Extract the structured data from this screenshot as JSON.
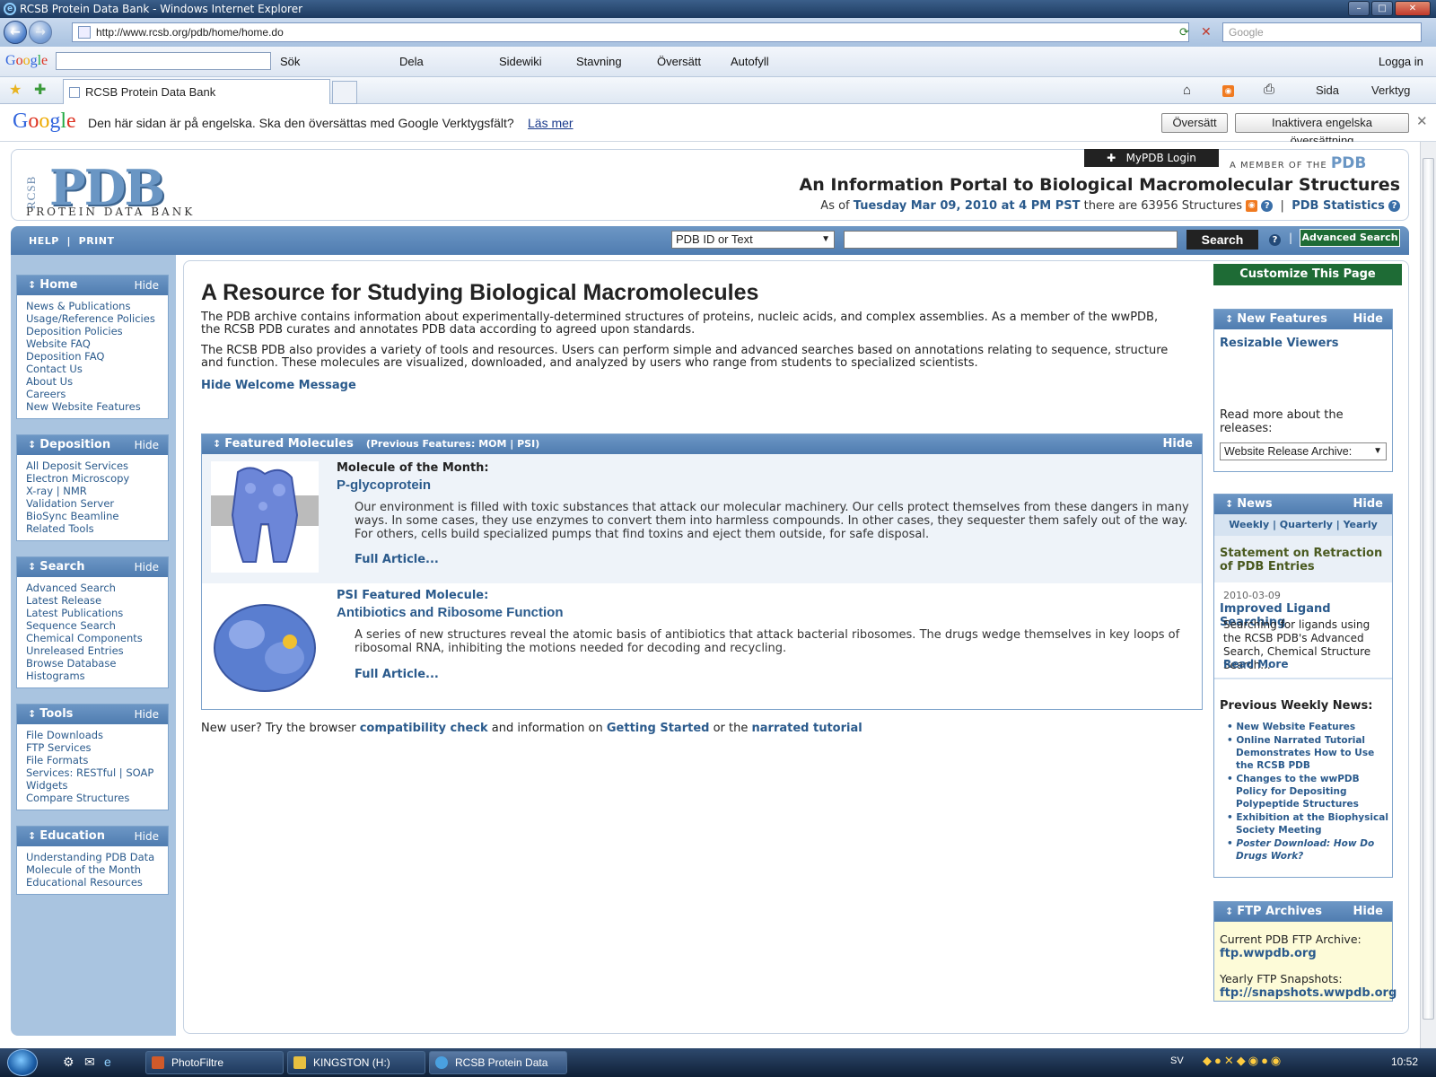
{
  "window": {
    "title": "RCSB Protein Data Bank - Windows Internet Explorer"
  },
  "browser": {
    "url": "http://www.rcsb.org/pdb/home/home.do",
    "search_placeholder": "Google",
    "tab_label": "RCSB Protein Data Bank",
    "google_toolbar": [
      "Sök",
      "Dela",
      "Sidewiki",
      "Stavning",
      "Översätt",
      "Autofyll",
      "Logga in"
    ],
    "command_bar": [
      "Sida",
      "Verktyg"
    ],
    "google_logo": "Google"
  },
  "translate_bar": {
    "message": "Den här sidan är på engelska. Ska den översättas med Google Verktygsfält?",
    "learn_more": "Läs mer",
    "translate_button": "Översätt",
    "disable_button": "Inaktivera engelska översättning"
  },
  "header": {
    "logo_rcsb": "RCSB",
    "logo_pdb": "PDB",
    "logo_sub": "PROTEIN DATA BANK",
    "mypdb": "MyPDB Login",
    "member_text": "A MEMBER OF THE",
    "member_pdb": "PDB",
    "portal_title": "An Information Portal to Biological Macromolecular Structures",
    "as_of": "As of",
    "date": "Tuesday Mar 09, 2010 at 4 PM PST",
    "there_are": "there are 63956 Structures",
    "stats_link": "PDB Statistics"
  },
  "searchbar": {
    "help": "HELP",
    "print": "PRINT",
    "select_value": "PDB ID or Text",
    "search_button": "Search",
    "advanced": "Advanced Search"
  },
  "sidebar": [
    {
      "title": "Home",
      "items": [
        "News & Publications",
        "Usage/Reference Policies",
        "Deposition Policies",
        "Website FAQ",
        "Deposition FAQ",
        "Contact Us",
        "About Us",
        "Careers",
        "New Website Features"
      ]
    },
    {
      "title": "Deposition",
      "items": [
        "All Deposit Services",
        "Electron Microscopy",
        "X-ray | NMR",
        "Validation Server",
        "BioSync Beamline",
        "Related Tools"
      ]
    },
    {
      "title": "Search",
      "items": [
        "Advanced Search",
        "Latest Release",
        "Latest Publications",
        "Sequence Search",
        "Chemical Components",
        "Unreleased Entries",
        "Browse Database",
        "Histograms"
      ]
    },
    {
      "title": "Tools",
      "items": [
        "File Downloads",
        "FTP Services",
        "File Formats",
        "Services: RESTful | SOAP",
        "Widgets",
        "Compare Structures"
      ]
    },
    {
      "title": "Education",
      "items": [
        "Understanding PDB Data",
        "Molecule of the Month",
        "Educational Resources"
      ]
    }
  ],
  "sidebar_hide": "Hide",
  "main": {
    "title": "A Resource for Studying Biological Macromolecules",
    "p1": "The PDB archive contains information about experimentally-determined structures of proteins, nucleic acids, and complex assemblies. As a member of the wwPDB, the RCSB PDB curates and annotates PDB data according to agreed upon standards.",
    "p2": "The RCSB PDB also provides a variety of tools and resources. Users can perform simple and advanced searches based on annotations relating to sequence, structure and function. These molecules are visualized, downloaded, and analyzed by users who range from students to specialized scientists.",
    "hide_welcome": "Hide Welcome Message",
    "featured_title": "Featured Molecules",
    "previous_features": "(Previous Features: MOM | PSI)",
    "mom_tag": "Molecule of the Month:",
    "mom_title": "P-glycoprotein",
    "mom_desc": "Our environment is filled with toxic substances that attack our molecular machinery. Our cells protect themselves from these dangers in many ways. In some cases, they use enzymes to convert them into harmless compounds. In other cases, they sequester them safely out of the way. For others, cells build specialized pumps that find toxins and eject them outside, for safe disposal.",
    "full_article": "Full Article...",
    "psi_tag": "PSI Featured Molecule:",
    "psi_title": "Antibiotics and Ribosome Function",
    "psi_desc": "A series of new structures reveal the atomic basis of antibiotics that attack bacterial ribosomes. The drugs wedge themselves in key loops of ribosomal RNA, inhibiting the motions needed for decoding and recycling.",
    "newuser_1": "New user? Try the browser",
    "newuser_link1": "compatibility check",
    "newuser_2": "and information on",
    "newuser_link2": "Getting Started",
    "newuser_3": "or the",
    "newuser_link3": "narrated tutorial"
  },
  "right": {
    "customize": "Customize This Page",
    "new_features_title": "New Features",
    "resizable": "Resizable Viewers",
    "read_more_releases": "Read more about the releases:",
    "release_select": "Website Release Archive:",
    "news_title": "News",
    "news_tabs": "Weekly | Quarterly | Yearly",
    "statement": "Statement on Retraction of PDB Entries",
    "news_date": "2010-03-09",
    "news_headline": "Improved Ligand Searching",
    "news_body": "Searching for ligands using the RCSB PDB's Advanced Search, Chemical Structure Search...",
    "read_more": "Read More",
    "prev_weekly": "Previous Weekly News:",
    "prev_items": [
      "New Website Features",
      "Online Narrated Tutorial Demonstrates How to Use the RCSB PDB",
      "Changes to the wwPDB Policy for Depositing Polypeptide Structures",
      "Exhibition at the Biophysical Society Meeting",
      "Poster Download: How Do Drugs Work?"
    ],
    "ftp_title": "FTP Archives",
    "ftp_current_label": "Current PDB FTP Archive:",
    "ftp_current": "ftp.wwpdb.org",
    "ftp_yearly_label": "Yearly FTP Snapshots:",
    "ftp_yearly": "ftp://snapshots.wwpdb.org",
    "hide": "Hide"
  },
  "taskbar": {
    "items": [
      "PhotoFiltre",
      "KINGSTON (H:)",
      "RCSB Protein Data B..."
    ],
    "lang": "SV",
    "clock": "10:52"
  }
}
